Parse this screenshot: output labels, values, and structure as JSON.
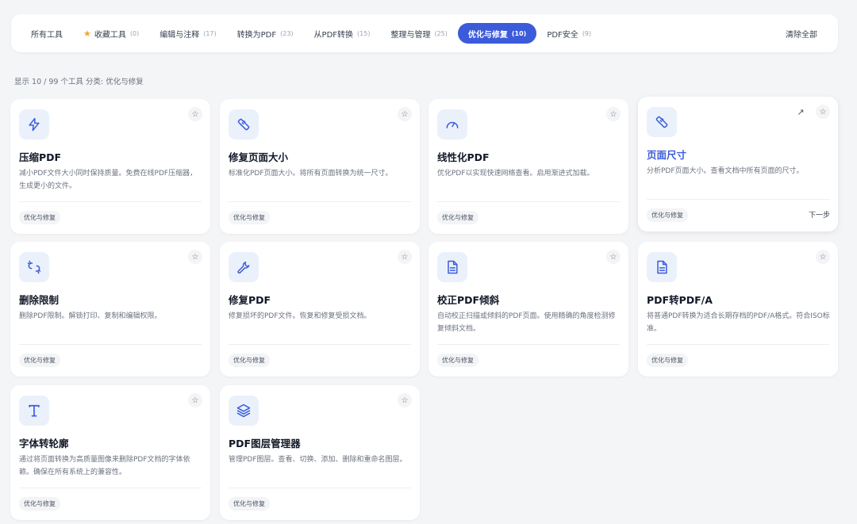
{
  "filter_bar": {
    "tabs": [
      {
        "label": "所有工具",
        "count": ""
      },
      {
        "label": "收藏工具",
        "count": "(0)",
        "star": true
      },
      {
        "label": "编辑与注释",
        "count": "(17)"
      },
      {
        "label": "转换为PDF",
        "count": "(23)"
      },
      {
        "label": "从PDF转换",
        "count": "(15)"
      },
      {
        "label": "整理与管理",
        "count": "(25)"
      },
      {
        "label": "优化与修复",
        "count": "(10)",
        "active": true
      },
      {
        "label": "PDF安全",
        "count": "(9)"
      }
    ],
    "clear_all": "清除全部"
  },
  "summary": "显示 10 / 99 个工具 分类: 优化与修复",
  "star_glyph": "☆",
  "arrow_glyph": "↗",
  "icon_color": "#3b5bdb",
  "accent_color": "#3b5bdb",
  "cards": [
    {
      "icon": "lightning-icon",
      "title": "压缩PDF",
      "desc": "减小PDF文件大小同时保持质量。免费在线PDF压缩器，生成更小的文件。",
      "tag": "优化与修复"
    },
    {
      "icon": "ruler-icon",
      "title": "修复页面大小",
      "desc": "标准化PDF页面大小。将所有页面转换为统一尺寸。",
      "tag": "优化与修复"
    },
    {
      "icon": "gauge-icon",
      "title": "线性化PDF",
      "desc": "优化PDF以实现快速网络查看。启用渐进式加载。",
      "tag": "优化与修复"
    },
    {
      "icon": "ruler-icon",
      "title": "页面尺寸",
      "desc": "分析PDF页面大小。查看文档中所有页面的尺寸。",
      "tag": "优化与修复",
      "next": "下一步",
      "highlight": true
    },
    {
      "icon": "broken-link-icon",
      "title": "删除限制",
      "desc": "删除PDF限制。解锁打印、复制和编辑权限。",
      "tag": "优化与修复"
    },
    {
      "icon": "wrench-icon",
      "title": "修复PDF",
      "desc": "修复损坏的PDF文件。恢复和修复受损文档。",
      "tag": "优化与修复"
    },
    {
      "icon": "document-icon",
      "title": "校正PDF倾斜",
      "desc": "自动校正扫描或倾斜的PDF页面。使用精确的角度检测修复倾斜文档。",
      "tag": "优化与修复"
    },
    {
      "icon": "document-icon",
      "title": "PDF转PDF/A",
      "desc": "将普通PDF转换为适合长期存档的PDF/A格式。符合ISO标准。",
      "tag": "优化与修复"
    },
    {
      "icon": "text-icon",
      "title": "字体转轮廓",
      "desc": "通过将页面转换为高质量图像来删除PDF文档的字体依赖。确保在所有系统上的兼容性。",
      "tag": "优化与修复"
    },
    {
      "icon": "layers-icon",
      "title": "PDF图层管理器",
      "desc": "管理PDF图层。查看、切换、添加、删除和重命名图层。",
      "tag": "优化与修复"
    }
  ]
}
